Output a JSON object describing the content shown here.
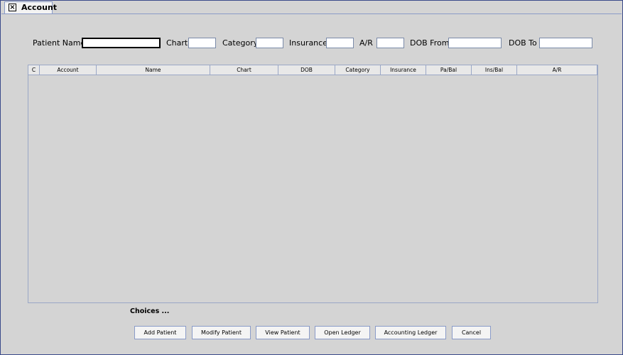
{
  "tab": {
    "title": "Account"
  },
  "filters": {
    "patient_name_label": "Patient Name",
    "patient_name_value": "",
    "chart_label": "Chart",
    "chart_value": "",
    "category_label": "Category",
    "category_value": "",
    "insurance_label": "Insurance",
    "insurance_value": "",
    "ar_label": "A/R",
    "ar_value": "",
    "dob_from_label": "DOB From",
    "dob_from_value": "",
    "dob_to_label": "DOB To",
    "dob_to_value": ""
  },
  "table": {
    "columns": [
      "C",
      "Account",
      "Name",
      "Chart",
      "DOB",
      "Category",
      "Insurance",
      "Pa/Bal",
      "Ins/Bal",
      "A/R"
    ],
    "rows": []
  },
  "choices_label": "Choices ...",
  "buttons": {
    "add_patient": "Add Patient",
    "modify_patient": "Modify Patient",
    "view_patient": "View Patient",
    "open_ledger": "Open Ledger",
    "accounting_ledger": "Accounting Ledger",
    "cancel": "Cancel"
  }
}
